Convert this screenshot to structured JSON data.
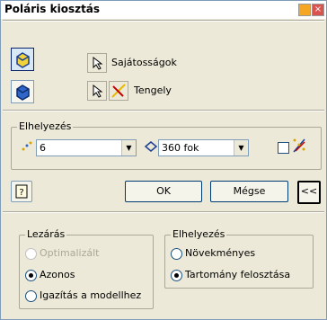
{
  "window": {
    "title": "Poláris kiosztás"
  },
  "icons": {
    "feature_body": "cube-yellow-icon",
    "feature_solid": "cube-blue-icon",
    "select": "arrow-pointer-icon",
    "axis": "axis-icon",
    "count": "dots-count-icon",
    "angle": "angle-icon",
    "flip": "flip-direction-icon",
    "help": "help-icon"
  },
  "labels": {
    "properties": "Sajátosságok",
    "axis": "Tengely"
  },
  "placement_group": {
    "legend": "Elhelyezés",
    "count_value": "6",
    "angle_value": "360 fok"
  },
  "buttons": {
    "ok": "OK",
    "cancel": "Mégse",
    "more": "<<"
  },
  "termination_group": {
    "legend": "Lezárás",
    "options": [
      "Optimalizált",
      "Azonos",
      "Igazítás a modellhez"
    ],
    "selected": "Azonos"
  },
  "placement_mode_group": {
    "legend": "Elhelyezés",
    "options": [
      "Növekményes",
      "Tartomány felosztása"
    ],
    "selected": "Tartomány felosztása"
  },
  "colors": {
    "accent": "#0a246a",
    "face": "#ece9d8"
  }
}
